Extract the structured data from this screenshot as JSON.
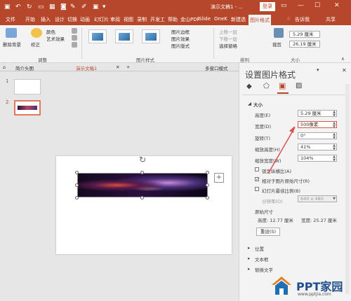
{
  "titlebar": {
    "title": "演示文稿1 - ...",
    "login": "登录"
  },
  "tabs": [
    "文件",
    "开始",
    "插入",
    "设计",
    "切换",
    "动画",
    "幻灯片",
    "审阅",
    "视图",
    "录制",
    "开发工",
    "帮助",
    "金山PDF",
    "iSlide",
    "OneK",
    "新建选",
    "图片格式",
    "告诉我",
    "共享"
  ],
  "ribbon": {
    "remove_bg": "删除背景",
    "correct": "校正",
    "color": "颜色",
    "art": "艺术效果",
    "adjust_group": "调整",
    "styles_group": "图片样式",
    "border": "图片边框",
    "effect": "图片效果",
    "layout": "图片版式",
    "bring_fwd": "上移一层",
    "send_back": "下移一层",
    "selection": "选择窗格",
    "arrange_group": "排列",
    "crop": "裁剪",
    "height_val": "5.29 厘米",
    "width_val": "26.19 厘米",
    "size_group": "大小"
  },
  "doctabs": {
    "tab1": "简介头图",
    "tab2": "演示文稿1",
    "tab3": "多窗口模式"
  },
  "slides": {
    "n1": "1",
    "n2": "2"
  },
  "panel": {
    "title": "设置图片格式",
    "size_section": "大小",
    "height_label": "高度(E)",
    "height_val": "5.29 厘米",
    "width_label": "宽度(D)",
    "width_val": "500像素",
    "rotation_label": "旋转(T)",
    "rotation_val": "0°",
    "scale_h_label": "缩放高度(H)",
    "scale_h_val": "41%",
    "scale_w_label": "缩放宽度(W)",
    "scale_w_val": "104%",
    "lock_aspect": "锁定纵横比(A)",
    "relative": "相对于图片原始尺寸(R)",
    "best_scale": "幻灯片最佳比例(B)",
    "resolution_label": "分辨率(O)",
    "resolution_val": "640 x 480",
    "original_size": "原始尺寸",
    "orig_h": "高度:  12.77 厘米",
    "orig_w": "宽度:  25.27 厘米",
    "reset": "重设(S)",
    "position": "位置",
    "textbox": "文本框",
    "alt_text": "替换文字"
  },
  "watermark": {
    "brand": "PPT家园",
    "url": "www.pptjia.com"
  },
  "colors": {
    "accent": "#b7472a",
    "highlight": "#d9534f"
  }
}
